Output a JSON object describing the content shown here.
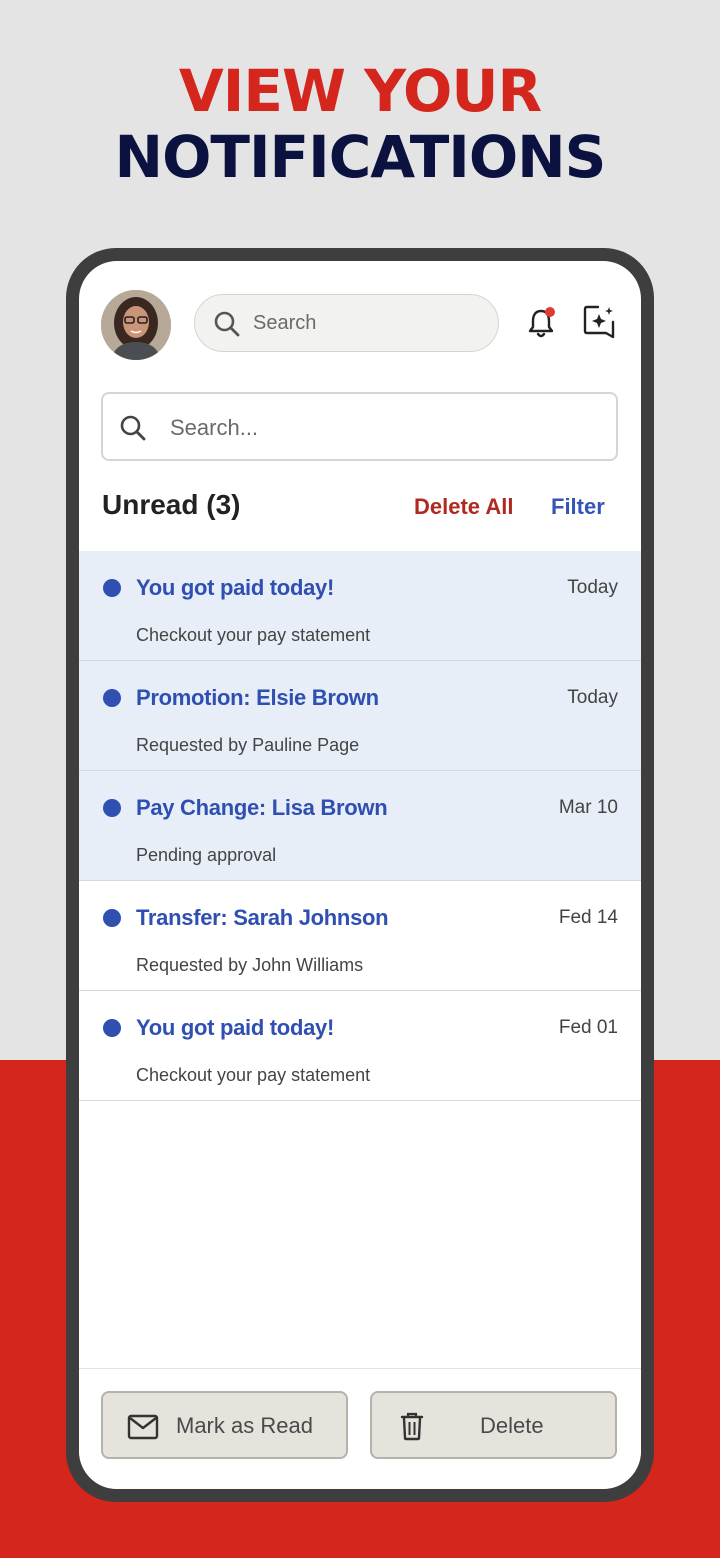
{
  "hero": {
    "line1": "VIEW YOUR",
    "line2": "NOTIFICATIONS"
  },
  "colors": {
    "brand_red": "#d4261d",
    "navy": "#0c1240",
    "accent_blue": "#2f4fb1",
    "unread_bg": "#e8eef8",
    "notification_dot": "#e23a2e"
  },
  "header": {
    "avatar": "user-avatar-photo",
    "search_placeholder": "Search",
    "icons": [
      "bell-icon",
      "sparkle-chat-icon"
    ]
  },
  "notifications_search": {
    "placeholder": "Search..."
  },
  "section": {
    "title": "Unread (3)",
    "delete_all": "Delete All",
    "filter": "Filter"
  },
  "notifications": [
    {
      "title": "You got paid today!",
      "subtitle": "Checkout your pay statement",
      "date": "Today",
      "unread": true
    },
    {
      "title": "Promotion: Elsie Brown",
      "subtitle": "Requested by Pauline Page",
      "date": "Today",
      "unread": true
    },
    {
      "title": "Pay Change: Lisa Brown",
      "subtitle": "Pending approval",
      "date": "Mar 10",
      "unread": true
    },
    {
      "title": "Transfer: Sarah Johnson",
      "subtitle": "Requested by John Williams",
      "date": "Fed 14",
      "unread": false
    },
    {
      "title": "You got paid today!",
      "subtitle": "Checkout your pay statement",
      "date": "Fed 01",
      "unread": false
    }
  ],
  "actions": {
    "mark_as_read": "Mark as Read",
    "delete": "Delete"
  }
}
